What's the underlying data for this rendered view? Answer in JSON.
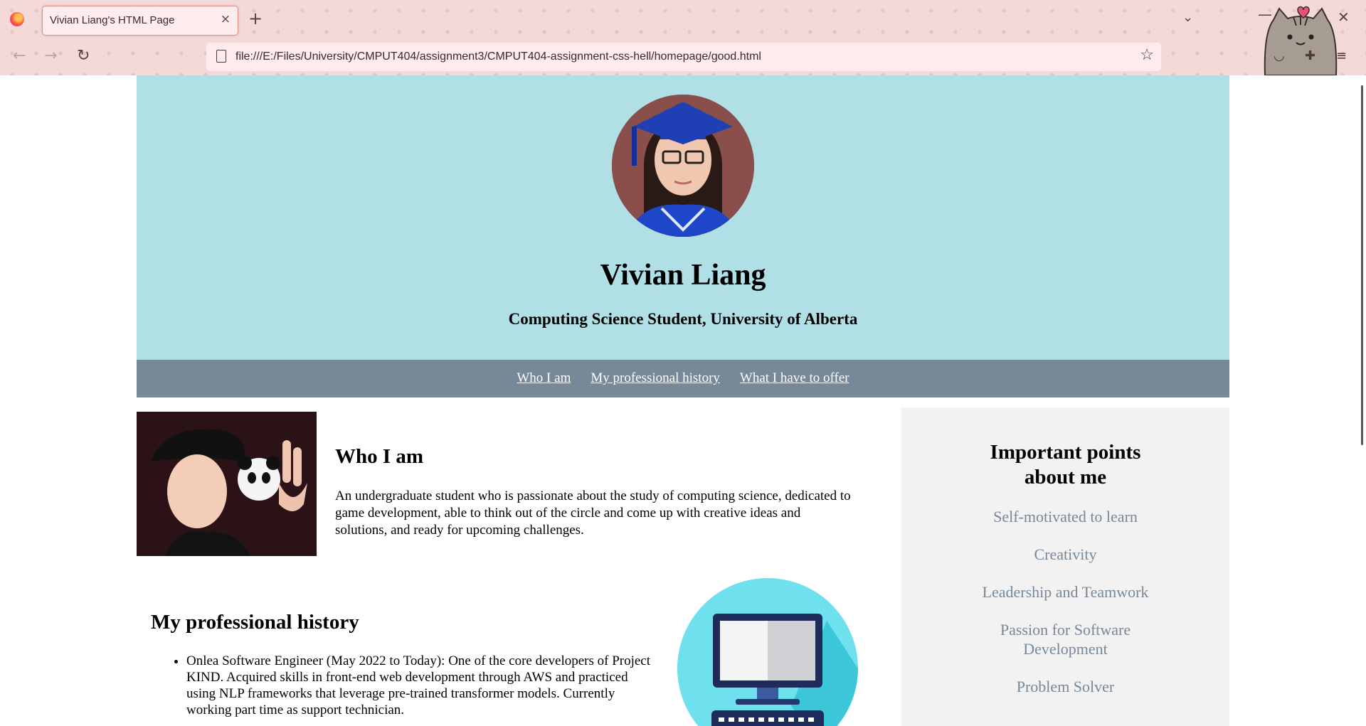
{
  "browser": {
    "tab_title": "Vivian Liang's HTML Page",
    "tab_close": "×",
    "new_tab": "+",
    "url": "file:///E:/Files/University/CMPUT404/assignment3/CMPUT404-assignment-css-hell/homepage/good.html",
    "glyphs": {
      "back": "←",
      "forward": "→",
      "reload": "↻",
      "star": "☆",
      "tablist": "⌄",
      "minimize": "—",
      "close": "✕",
      "pocket": "◡",
      "extensions": "✚",
      "menu": "≡"
    }
  },
  "header": {
    "name": "Vivian Liang",
    "subtitle": "Computing Science Student, University of Alberta",
    "bg_color": "#b0dfe5"
  },
  "nav": {
    "links": [
      "Who I am",
      "My professional history",
      "What I have to offer"
    ],
    "bg_color": "#778899"
  },
  "who": {
    "title": "Who I am",
    "text": "An undergraduate student who is passionate about the study of computing science, dedicated to game development, able to think out of the circle and come up with creative ideas and solutions, and ready for upcoming challenges."
  },
  "professional": {
    "title": "My professional history",
    "items": [
      "Onlea Software Engineer (May 2022 to Today): One of the core developers of Project KIND. Acquired skills in front-end web development through AWS and practiced using NLP frameworks that leverage pre-trained transformer models. Currently working part time as support technician."
    ]
  },
  "aside": {
    "title": "Important points about me",
    "items": [
      "Self-motivated to learn",
      "Creativity",
      "Leadership and Teamwork",
      "Passion for Software Development",
      "Problem Solver"
    ],
    "text_color": "#778899"
  }
}
